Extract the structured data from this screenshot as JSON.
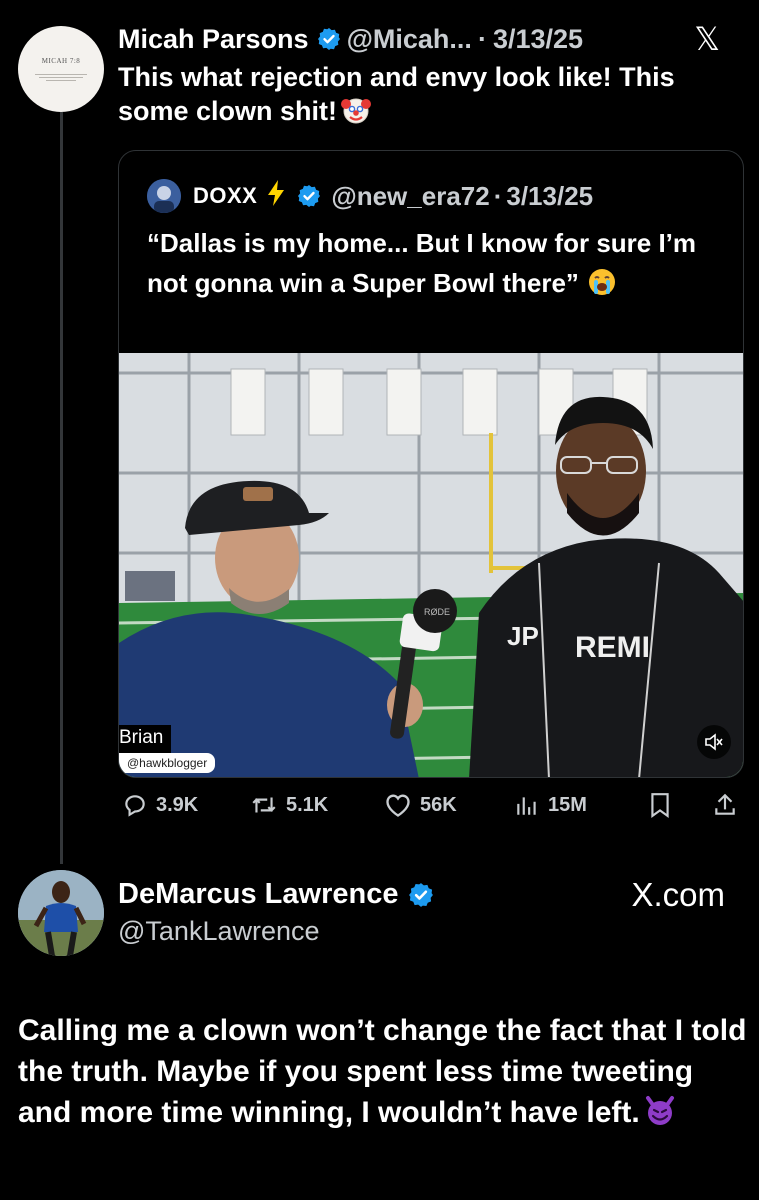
{
  "tweet1": {
    "name": "Micah Parsons",
    "handle": "@Micah...",
    "separator": "·",
    "date": "3/13/25",
    "platform_mark": "𝕏",
    "text": "This what rejection and envy look like! This some clown shit!",
    "emoji": "clown-face-emoji",
    "avatar_text": "MICAH 7:8",
    "quote": {
      "name": "DOXX",
      "handle": "@new_era72",
      "separator": "·",
      "date": "3/13/25",
      "text": "“Dallas is my home... But I know for sure I’m not gonna win a Super Bowl there”",
      "emoji": "crying-face-emoji",
      "video": {
        "name_tag": "Brian",
        "handle_tag": "@hawkblogger",
        "mic_label": "RØDE",
        "hoodie_left": "JP",
        "hoodie_right": "REMI",
        "muted": true
      }
    },
    "stats": {
      "replies": "3.9K",
      "reposts": "5.1K",
      "likes": "56K",
      "views": "15M"
    }
  },
  "tweet2": {
    "name": "DeMarcus Lawrence",
    "handle": "@TankLawrence",
    "source": "X.com",
    "text": "Calling me a clown won’t change the fact that I told the truth. Maybe if you spent less time tweeting and more time winning, I wouldn’t have left.",
    "emoji": "smiling-devil-emoji"
  },
  "colors": {
    "background": "#000000",
    "verified": "#1d9bf0",
    "muted_text": "#c9cdd1",
    "bolt": "#ffd400",
    "field": "#2f8a3c"
  }
}
